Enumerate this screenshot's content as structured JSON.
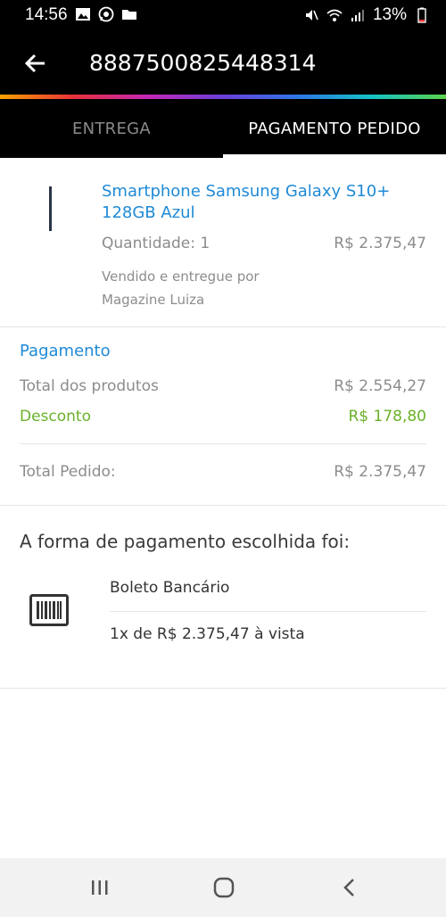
{
  "status": {
    "time": "14:56",
    "battery": "13%"
  },
  "header": {
    "title": "8887500825448314"
  },
  "tabs": [
    {
      "label": "ENTREGA"
    },
    {
      "label": "PAGAMENTO PEDIDO"
    }
  ],
  "product": {
    "name": "Smartphone Samsung Galaxy S10+ 128GB Azul",
    "quantity_label": "Quantidade: 1",
    "price": "R$ 2.375,47",
    "seller": "Vendido e entregue por Magazine Luiza"
  },
  "payment": {
    "title": "Pagamento",
    "products_label": "Total dos produtos",
    "products_value": "R$ 2.554,27",
    "discount_label": "Desconto",
    "discount_value": "R$ 178,80",
    "total_label": "Total Pedido:",
    "total_value": "R$ 2.375,47"
  },
  "method": {
    "heading": "A forma de pagamento escolhida foi:",
    "name": "Boleto Bancário",
    "installment": "1x de R$ 2.375,47 à vista",
    "icon": "barcode-icon"
  },
  "colors": {
    "accent_blue": "#1f8ad6",
    "discount_green": "#6bb12a",
    "header_bg": "#000000"
  }
}
